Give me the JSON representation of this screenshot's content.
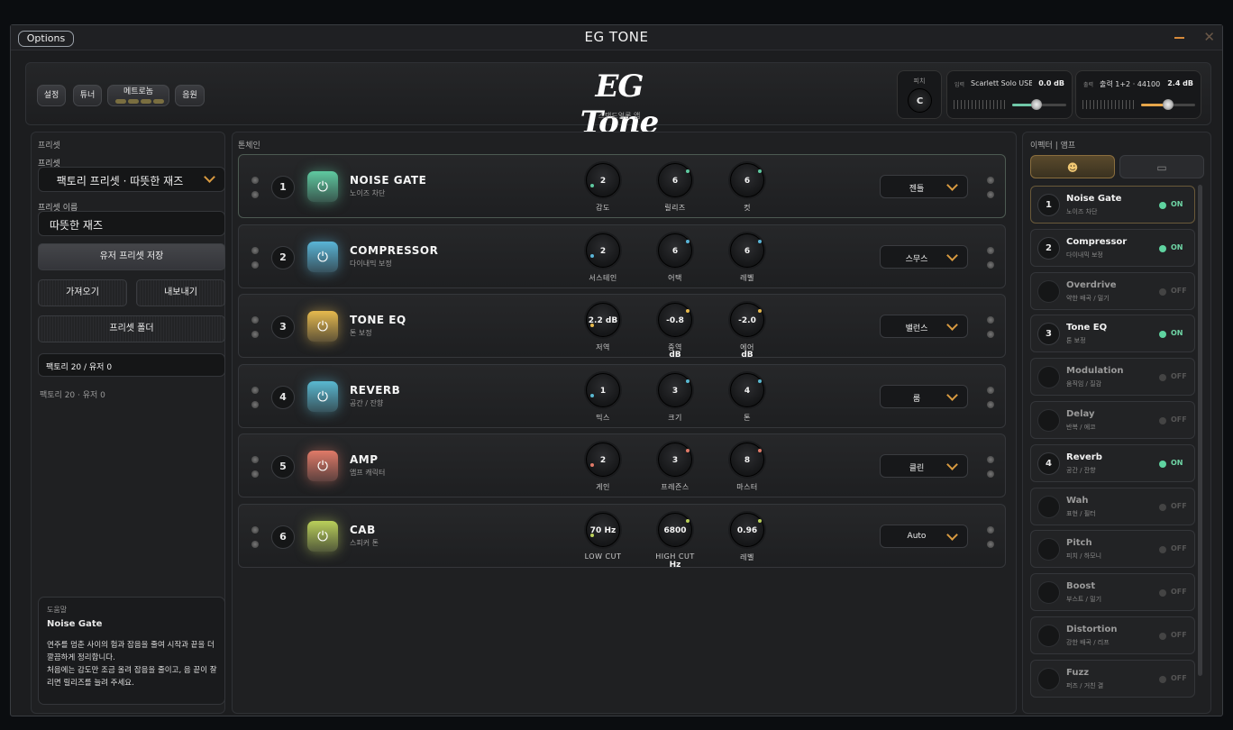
{
  "titlebar": {
    "options": "Options",
    "title": "EG TONE"
  },
  "header": {
    "buttons": [
      "설정",
      "튜너",
      "메트로놈",
      "음원"
    ],
    "logo": "EG Tone",
    "logo_sub": "스탠드얼론 앱",
    "tuning_label": "피치",
    "tuning_value": "C",
    "input": {
      "label": "입력",
      "name": "Scarlett Solo USB...",
      "value": "0.0 dB",
      "level": 0.45
    },
    "output": {
      "label": "출력",
      "name": "출력 1+2 · 44100 ...",
      "value": "2.4 dB",
      "level": 0.5
    }
  },
  "left": {
    "section": "프리셋",
    "preset_label": "프리셋",
    "preset_value": "팩토리 프리셋 · 따뜻한 재즈",
    "name_label": "프리셋 이름",
    "name_value": "따뜻한 재즈",
    "save": "유저 프리셋 저장",
    "import": "가져오기",
    "export": "내보내기",
    "folder": "프리셋 폴더",
    "count_box": "팩토리 20 / 유저 0",
    "count_text": "팩토리 20 · 유저 0",
    "help": {
      "label": "도움말",
      "title": "Noise Gate",
      "body": "연주를 멈춘 사이의 험과 잡음을 줄여 시작과 끝을 더 깔끔하게 정리합니다.\n처음에는 감도만 조금 올려 잡음을 줄이고, 음 끝이 잘리면 릴리즈를 늘려 주세요."
    }
  },
  "chain": {
    "title": "톤체인",
    "slots": [
      {
        "num": "1",
        "name": "NOISE GATE",
        "sub": "노이즈 차단",
        "color": "#5fc9a0",
        "knobs": [
          {
            "value": "2",
            "label": "감도"
          },
          {
            "value": "6",
            "label": "릴리즈"
          },
          {
            "value": "6",
            "label": "컷"
          }
        ],
        "preset": "젠틀"
      },
      {
        "num": "2",
        "name": "COMPRESSOR",
        "sub": "다이내믹 보정",
        "color": "#5ab4d6",
        "knobs": [
          {
            "value": "2",
            "label": "서스테인"
          },
          {
            "value": "6",
            "label": "어택"
          },
          {
            "value": "6",
            "label": "레벨"
          }
        ],
        "preset": "스무스"
      },
      {
        "num": "3",
        "name": "TONE EQ",
        "sub": "톤 보정",
        "color": "#e6b94e",
        "knobs": [
          {
            "value": "2.2 dB",
            "label": "저역"
          },
          {
            "value": "-0.8 dB",
            "label": "중역"
          },
          {
            "value": "-2.0 dB",
            "label": "에어"
          }
        ],
        "preset": "밸런스"
      },
      {
        "num": "4",
        "name": "REVERB",
        "sub": "공간 / 잔향",
        "color": "#5ab8d0",
        "knobs": [
          {
            "value": "1",
            "label": "믹스"
          },
          {
            "value": "3",
            "label": "크기"
          },
          {
            "value": "4",
            "label": "톤"
          }
        ],
        "preset": "룸"
      },
      {
        "num": "5",
        "name": "AMP",
        "sub": "앰프 캐릭터",
        "color": "#e07a68",
        "knobs": [
          {
            "value": "2",
            "label": "게인"
          },
          {
            "value": "3",
            "label": "프레즌스"
          },
          {
            "value": "8",
            "label": "마스터"
          }
        ],
        "preset": "클린"
      },
      {
        "num": "6",
        "name": "CAB",
        "sub": "스피커 톤",
        "color": "#b9cf5a",
        "knobs": [
          {
            "value": "70 Hz",
            "label": "LOW CUT"
          },
          {
            "value": "6800 Hz",
            "label": "HIGH CUT"
          },
          {
            "value": "0.96",
            "label": "레벨"
          }
        ],
        "preset": "Auto"
      }
    ]
  },
  "right": {
    "title": "이펙터 | 앰프",
    "effects": [
      {
        "num": "1",
        "name": "Noise Gate",
        "sub": "노이즈 차단",
        "state": "ON"
      },
      {
        "num": "2",
        "name": "Compressor",
        "sub": "다이내믹 보정",
        "state": "ON"
      },
      {
        "num": "",
        "name": "Overdrive",
        "sub": "약한 배곡 / 밀기",
        "state": "OFF"
      },
      {
        "num": "3",
        "name": "Tone EQ",
        "sub": "톤 보정",
        "state": "ON"
      },
      {
        "num": "",
        "name": "Modulation",
        "sub": "움직임 / 질감",
        "state": "OFF"
      },
      {
        "num": "",
        "name": "Delay",
        "sub": "반복 / 에코",
        "state": "OFF"
      },
      {
        "num": "4",
        "name": "Reverb",
        "sub": "공간 / 잔향",
        "state": "ON"
      },
      {
        "num": "",
        "name": "Wah",
        "sub": "표현 / 필터",
        "state": "OFF"
      },
      {
        "num": "",
        "name": "Pitch",
        "sub": "피치 / 하모니",
        "state": "OFF"
      },
      {
        "num": "",
        "name": "Boost",
        "sub": "부스트 / 밀기",
        "state": "OFF"
      },
      {
        "num": "",
        "name": "Distortion",
        "sub": "강한 배곡 / 리프",
        "state": "OFF"
      },
      {
        "num": "",
        "name": "Fuzz",
        "sub": "퍼즈 / 거친 결",
        "state": "OFF"
      }
    ]
  }
}
